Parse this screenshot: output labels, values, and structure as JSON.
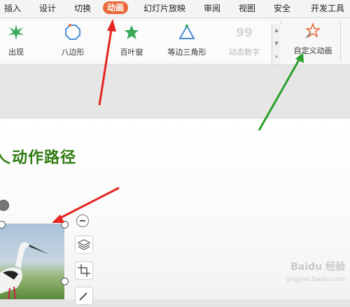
{
  "menu": {
    "items": [
      {
        "label": "插入",
        "name": "menu-insert"
      },
      {
        "label": "设计",
        "name": "menu-design"
      },
      {
        "label": "切换",
        "name": "menu-transition"
      },
      {
        "label": "动画",
        "name": "menu-animation",
        "active": true
      },
      {
        "label": "幻灯片放映",
        "name": "menu-slideshow"
      },
      {
        "label": "审阅",
        "name": "menu-review"
      },
      {
        "label": "视图",
        "name": "menu-view"
      },
      {
        "label": "安全",
        "name": "menu-security"
      },
      {
        "label": "开发工具",
        "name": "menu-developer"
      }
    ],
    "active_color": "#e8683a"
  },
  "ribbon": {
    "effects": [
      {
        "label": "出现",
        "icon": "star-burst-icon"
      },
      {
        "label": "八边形",
        "icon": "octagon-icon"
      },
      {
        "label": "百叶窗",
        "icon": "star-icon"
      },
      {
        "label": "等边三角形",
        "icon": "triangle-icon"
      },
      {
        "label": "动态数字",
        "icon": "number-99-icon",
        "disabled": true
      }
    ],
    "custom_animation_label": "自定义动画",
    "effect_color": "#3aaa5a"
  },
  "slide": {
    "title": "动作路径",
    "title_color": "#2f7d10"
  },
  "watermark": {
    "text": "Baidu 经验",
    "url": "jingyan.baidu.com"
  },
  "annotations": {
    "red_arrow_color": "#e52521",
    "green_arrow_color": "#2ca02c"
  }
}
